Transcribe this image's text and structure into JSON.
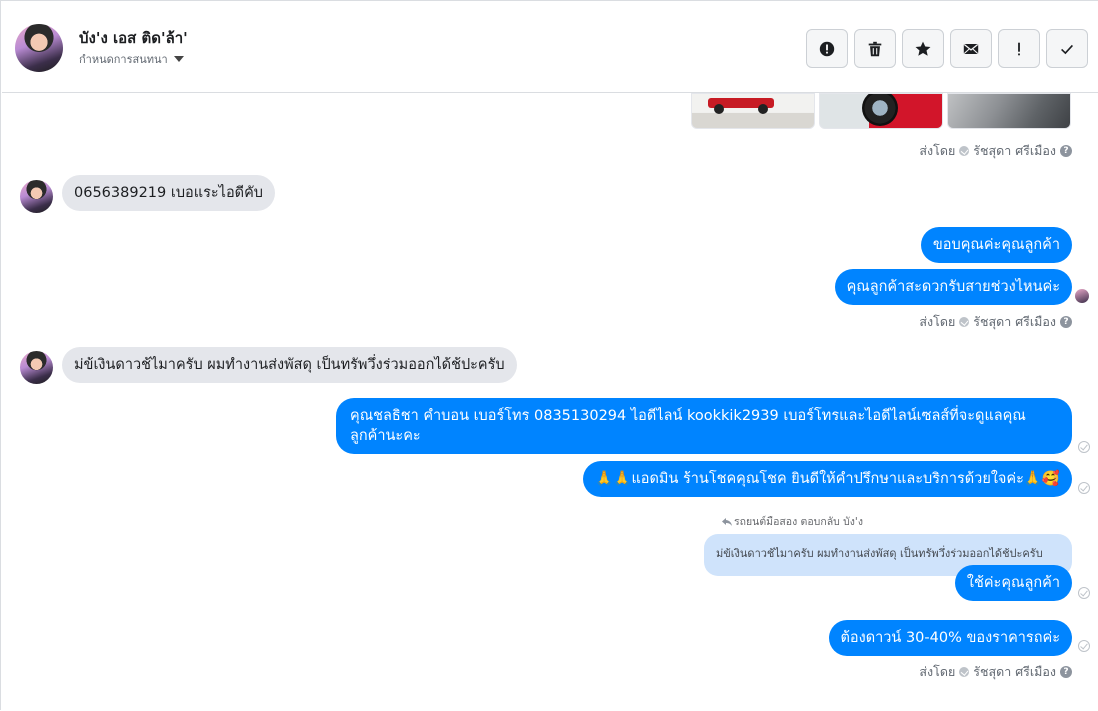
{
  "header": {
    "contact_name": "บัง'ง เอส ติด'ล้า'",
    "assign_label": "กำหนดการสนทนา"
  },
  "toolbar": [
    {
      "name": "mark-spam-button",
      "icon": "alert-circle-icon"
    },
    {
      "name": "delete-button",
      "icon": "trash-icon"
    },
    {
      "name": "star-button",
      "icon": "star-icon"
    },
    {
      "name": "mark-unread-button",
      "icon": "envelope-icon"
    },
    {
      "name": "follow-up-button",
      "icon": "exclamation-icon"
    },
    {
      "name": "mark-done-button",
      "icon": "check-icon"
    }
  ],
  "sent_by": {
    "prefix": "ส่งโดย",
    "agent": "รัชสุดา ศรีเมือง"
  },
  "messages": {
    "m1": "0656389219  เบอแระไอดีคับ",
    "m2": "ขอบคุณค่ะคุณลูกค้า",
    "m3": "คุณลูกค้าสะดวกรับสายช่วงไหนค่ะ",
    "m4": "ม่ข้เงินดาวช้ไมาครับ ผมทำงานส่งพัสดุ เป็นทรัพวึ่งร่วมออกได้ช้ปะครับ",
    "m5": "คุณชลธิชา คำบอน เบอร์โทร 0835130294  ไอดีไลน์ kookkik2939   เบอร์โทรและไอดีไลน์เซลส์ที่จะดูแลคุณลูกค้านะคะ",
    "m6": "🙏🙏แอดมิน ร้านโชคคุณโชค ยินดีให้คำปรึกษาและบริการด้วยใจค่ะ🙏🥰",
    "reply_meta": "รถยนต์มือสอง ตอบกลับ บัง'ง",
    "quoted": "ม่ข้เงินดาวช้ไมาครับ ผมทำงานส่งพัสดุ เป็นทรัพวึ่งร่วมออกได้ช้ปะครับ",
    "m7": "ใช้ค่ะคุณลูกค้า",
    "m8": "ต้องดาวน์ 30-40% ของราคารถค่ะ"
  }
}
